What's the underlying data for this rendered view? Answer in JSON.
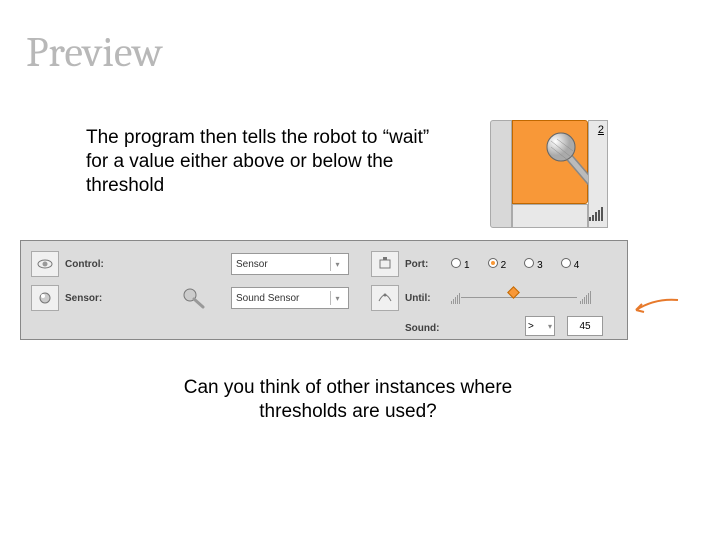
{
  "title": "Preview",
  "intro": "The program then tells the robot to “wait” for a value either above or below the threshold",
  "closing": "Can you think of other instances where thresholds are used?",
  "block": {
    "port": "2"
  },
  "panel": {
    "control": {
      "label": "Control:",
      "value": "Sensor"
    },
    "sensor": {
      "label": "Sensor:",
      "value": "Sound Sensor"
    },
    "port": {
      "label": "Port:",
      "options": [
        "1",
        "2",
        "3",
        "4"
      ],
      "selected": "2"
    },
    "until": {
      "label": "Until:"
    },
    "sound": {
      "label": "Sound:",
      "comparison": ">",
      "value": "45"
    }
  }
}
